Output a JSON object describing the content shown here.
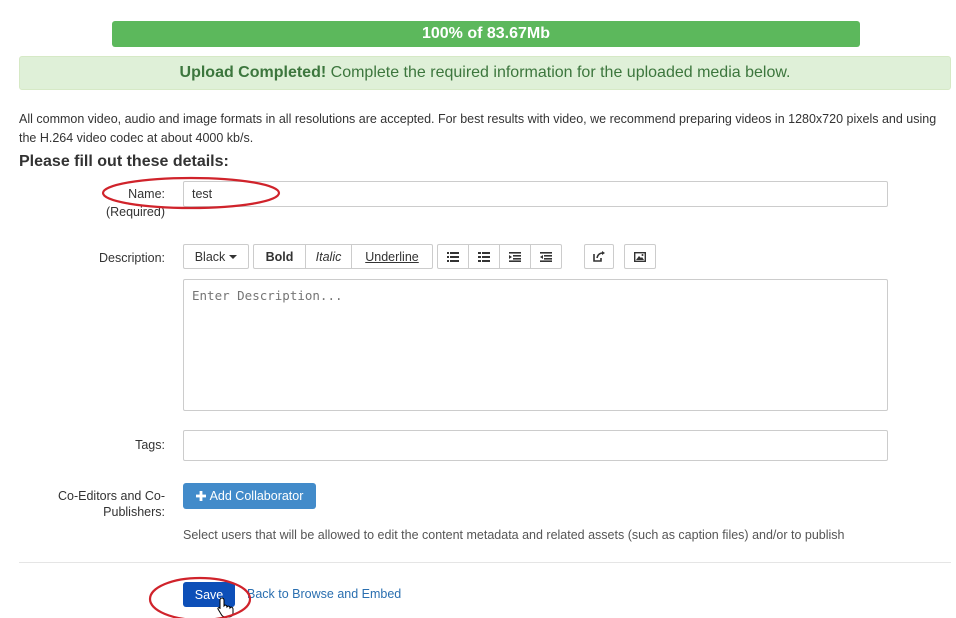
{
  "progress": {
    "text": "100% of 83.67Mb",
    "percent": 100,
    "color": "#5cb85c"
  },
  "alert": {
    "strong": "Upload Completed!",
    "message": " Complete the required information for the uploaded media below.",
    "bg_color": "#dff0d8"
  },
  "info_text": "All common video, audio and image formats in all resolutions are accepted. For best results with video, we recommend preparing videos in 1280x720 pixels and using the H.264 video codec at about 4000 kb/s.",
  "form": {
    "heading": "Please fill out these details:",
    "name": {
      "label": "Name:",
      "required_note": "(Required)",
      "value": "test"
    },
    "description": {
      "label": "Description:",
      "placeholder": "Enter Description...",
      "toolbar": {
        "color_label": "Black",
        "bold": "Bold",
        "italic": "Italic",
        "underline": "Underline",
        "icons": [
          "unordered-list-icon",
          "ordered-list-icon",
          "outdent-icon",
          "indent-icon",
          "link-icon",
          "image-icon"
        ]
      }
    },
    "tags": {
      "label": "Tags:",
      "value": ""
    },
    "collaborators": {
      "label": "Co-Editors and Co-Publishers:",
      "button_label": "Add Collaborator",
      "button_icon": "plus-icon",
      "help": "Select users that will be allowed to edit the content metadata and related assets (such as caption files) and/or to publish"
    }
  },
  "actions": {
    "save_label": "Save",
    "back_label": "Back to Browse and Embed",
    "primary_color": "#0d4fb8"
  },
  "annotations": {
    "circle_color": "#d0232b"
  }
}
